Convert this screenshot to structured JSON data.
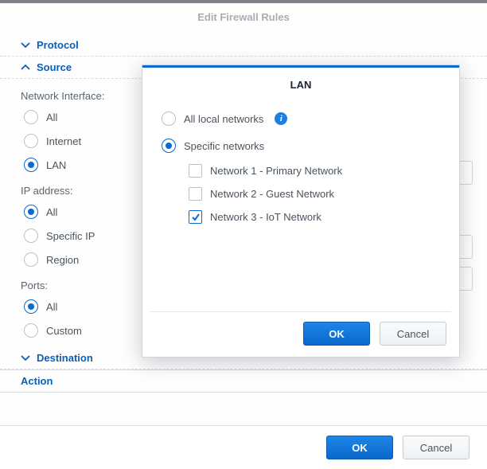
{
  "title": "Edit Firewall Rules",
  "sections": {
    "protocol": "Protocol",
    "source": "Source",
    "destination": "Destination",
    "action": "Action"
  },
  "source": {
    "network_interface_label": "Network Interface:",
    "interface_options": {
      "all": "All",
      "internet": "Internet",
      "lan": "LAN"
    },
    "interface_selected": "lan",
    "ip_label": "IP address:",
    "ip_options": {
      "all": "All",
      "specific": "Specific IP",
      "region": "Region"
    },
    "ip_selected": "all",
    "ports_label": "Ports:",
    "ports_options": {
      "all": "All",
      "custom": "Custom"
    },
    "ports_selected": "all"
  },
  "modal": {
    "title": "LAN",
    "scope_options": {
      "all": "All local networks",
      "specific": "Specific networks"
    },
    "scope_selected": "specific",
    "networks": [
      {
        "label": "Network 1 - Primary Network",
        "checked": false
      },
      {
        "label": "Network 2 - Guest Network",
        "checked": false
      },
      {
        "label": "Network 3 - IoT Network",
        "checked": true
      }
    ],
    "ok": "OK",
    "cancel": "Cancel"
  },
  "footer": {
    "ok": "OK",
    "cancel": "Cancel"
  }
}
